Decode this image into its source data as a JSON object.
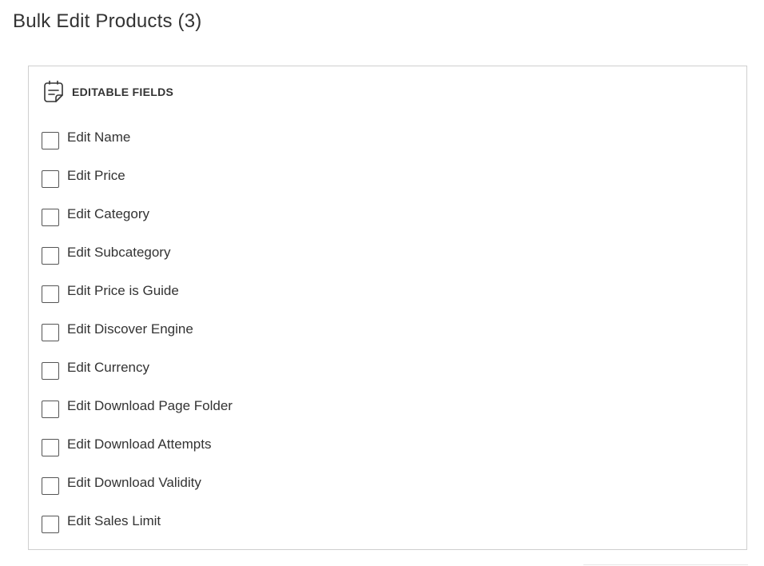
{
  "page": {
    "title": "Bulk Edit Products (3)"
  },
  "panel": {
    "title": "EDITABLE FIELDS",
    "icon": "notes-icon",
    "fields": [
      {
        "label": "Edit Name",
        "checked": false
      },
      {
        "label": "Edit Price",
        "checked": false
      },
      {
        "label": "Edit Category",
        "checked": false
      },
      {
        "label": "Edit Subcategory",
        "checked": false
      },
      {
        "label": "Edit Price is Guide",
        "checked": false
      },
      {
        "label": "Edit Discover Engine",
        "checked": false
      },
      {
        "label": "Edit Currency",
        "checked": false
      },
      {
        "label": "Edit Download Page Folder",
        "checked": false
      },
      {
        "label": "Edit Download Attempts",
        "checked": false
      },
      {
        "label": "Edit Download Validity",
        "checked": false
      },
      {
        "label": "Edit Sales Limit",
        "checked": false
      }
    ]
  },
  "colors": {
    "text": "#333333",
    "border": "#cfcfcf",
    "checkbox_border": "#555555",
    "background": "#ffffff"
  }
}
